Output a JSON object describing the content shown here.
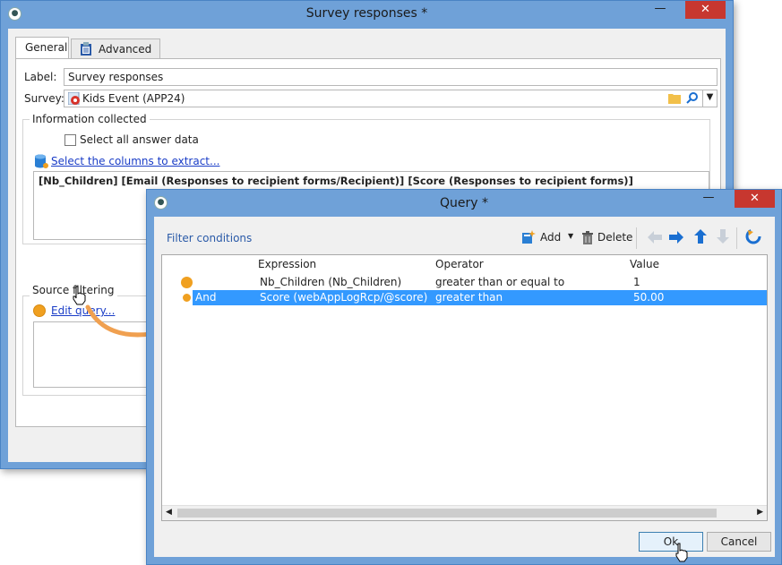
{
  "survey_window": {
    "title": "Survey responses *",
    "minimize": "—",
    "close": "✕",
    "tabs": [
      {
        "label": "General"
      },
      {
        "label": "Advanced"
      }
    ],
    "label_field": {
      "label": "Label:",
      "value": "Survey responses"
    },
    "survey_field": {
      "label": "Survey:",
      "value": "Kids Event (APP24)"
    },
    "info_group": {
      "legend": "Information collected",
      "select_all": "Select all answer data",
      "columns_link": "Select the columns to extract...",
      "columns_text": "[Nb_Children]  [Email (Responses to recipient forms/Recipient)]  [Score (Responses to recipient forms)]"
    },
    "source_group": {
      "legend": "Source filtering",
      "edit_link": "Edit query..."
    }
  },
  "query_window": {
    "title": "Query *",
    "minimize": "—",
    "close": "✕",
    "filter_label": "Filter conditions",
    "toolbar": {
      "add": "Add",
      "delete": "Delete"
    },
    "columns": [
      "Expression",
      "Operator",
      "Value"
    ],
    "rows": [
      {
        "logic": "",
        "expression": "Nb_Children (Nb_Children)",
        "operator": "greater than or equal to",
        "value": "1"
      },
      {
        "logic": "And",
        "expression": "Score (webAppLogRcp/@score)",
        "operator": "greater than",
        "value": "50.00"
      }
    ],
    "ok": "Ok",
    "cancel": "Cancel"
  },
  "colors": {
    "accent": "#3399ff",
    "titlebar": "#6fa1d8",
    "close": "#c7372f",
    "link": "#1a3dc7",
    "dot": "#f0a020",
    "arrow": "#f0a050"
  }
}
